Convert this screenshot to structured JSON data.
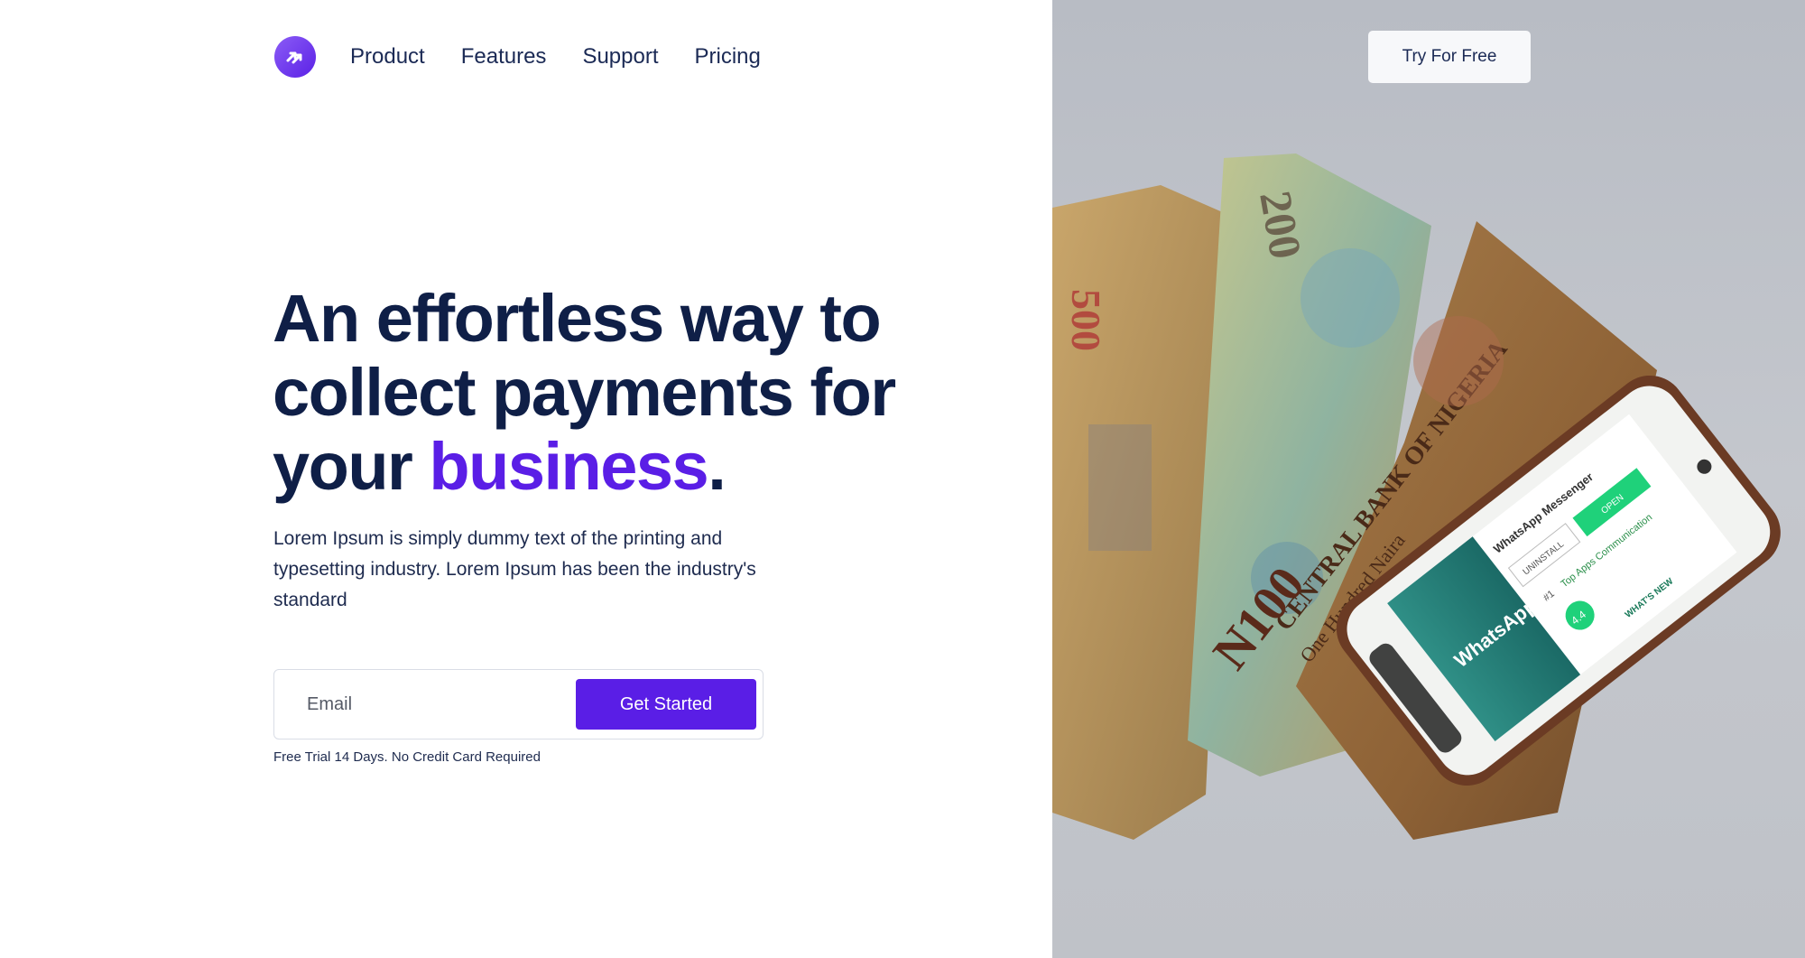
{
  "nav": {
    "logo_icon": "double-arrow-icon",
    "items": [
      {
        "label": "Product"
      },
      {
        "label": "Features"
      },
      {
        "label": "Support"
      },
      {
        "label": "Pricing"
      }
    ],
    "cta_label": "Try For Free"
  },
  "hero": {
    "headline_line1": "An effortless way to",
    "headline_line2": "collect payments for",
    "headline_line3_prefix": "your ",
    "headline_accent": "business",
    "headline_suffix": ".",
    "subtext": "Lorem Ipsum is simply dummy text of the printing and typesetting industry. Lorem Ipsum has been the industry's standard",
    "email_placeholder": "Email",
    "submit_label": "Get Started",
    "note": "Free Trial 14 Days. No Credit Card Required"
  },
  "photo": {
    "notes": [
      {
        "text": "500"
      },
      {
        "text": "200"
      },
      {
        "text": "CENTRAL BANK OF NIGERIA"
      },
      {
        "text": "One Hundred Naira"
      },
      {
        "text": "N100"
      }
    ],
    "phone": {
      "app_name": "WhatsApp",
      "listing_title": "WhatsApp Messenger",
      "uninstall_label": "UNINSTALL",
      "open_label": "OPEN",
      "rank_label": "#1",
      "category_label": "Top Apps Communication",
      "rating": "4.4",
      "whats_new_label": "WHAT'S NEW"
    }
  },
  "colors": {
    "accent": "#5a1ee6",
    "heading": "#0f1f47",
    "whatsapp": "#1f8a7a"
  }
}
